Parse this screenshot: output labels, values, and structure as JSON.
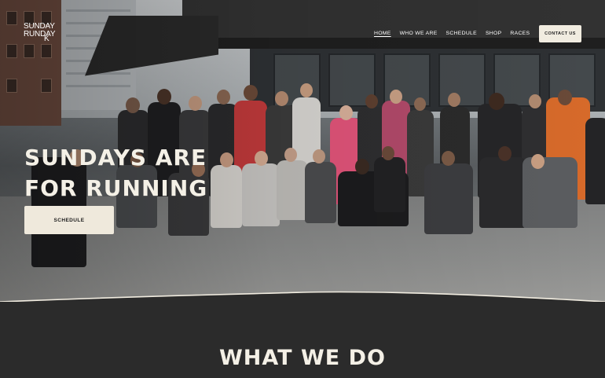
{
  "brand": {
    "logo_line1": "SUNDAY",
    "logo_line2": "RUNDAY",
    "logo_mark": "K",
    "text_color": "#ffffff"
  },
  "nav": {
    "items": [
      {
        "label": "HOME",
        "active": true
      },
      {
        "label": "WHO WE ARE",
        "active": false
      },
      {
        "label": "SCHEDULE",
        "active": false
      },
      {
        "label": "SHOP",
        "active": false
      },
      {
        "label": "RACES",
        "active": false
      }
    ],
    "contact_label": "CONTACT US"
  },
  "hero": {
    "title_line1": "SUNDAYS ARE",
    "title_line2": "FOR RUNNING",
    "cta_label": "SCHEDULE",
    "image_description_icon": "group-photo-image"
  },
  "section": {
    "title": "WHAT WE DO"
  },
  "colors": {
    "cream": "#f1ece0",
    "dark": "#2b2b2b",
    "title": "#f4f0e6"
  }
}
